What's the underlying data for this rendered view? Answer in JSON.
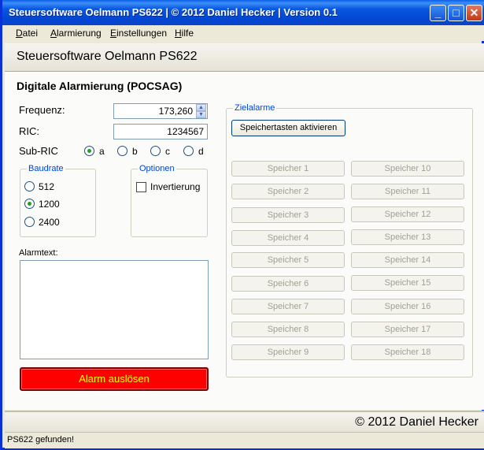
{
  "window": {
    "title": "Steuersoftware Oelmann PS622  |  © 2012 Daniel Hecker  |  Version 0.1",
    "minimize_glyph": "_",
    "maximize_glyph": "□",
    "close_glyph": "✕"
  },
  "menu": {
    "items": [
      {
        "first": "D",
        "rest": "atei"
      },
      {
        "first": "A",
        "rest": "larmierung"
      },
      {
        "first": "E",
        "rest": "instellungen"
      },
      {
        "first": "H",
        "rest": "ilfe"
      }
    ]
  },
  "header": {
    "title": "Steuersoftware Oelmann PS622"
  },
  "main": {
    "section_title": "Digitale Alarmierung (POCSAG)",
    "frequency_label": "Frequenz:",
    "frequency_value": "173,260",
    "spin_up": "▲",
    "spin_down": "▼",
    "ric_label": "RIC:",
    "ric_value": "1234567",
    "subric_label": "Sub-RIC",
    "subric_options": [
      "a",
      "b",
      "c",
      "d"
    ],
    "subric_selected": "a",
    "baudrate": {
      "legend": "Baudrate",
      "options": [
        "512",
        "1200",
        "2400"
      ],
      "selected": "1200"
    },
    "options_group": {
      "legend": "Optionen",
      "invert_label": "Invertierung",
      "invert_checked": false
    },
    "alarmtext_label": "Alarmtext:",
    "alarmtext_value": "",
    "alarm_button": "Alarm auslösen"
  },
  "zielalarme": {
    "legend": "Zielalarme",
    "activate_button": "Speichertasten aktivieren",
    "memory_left": [
      "Speicher 1",
      "Speicher 2",
      "Speicher 3",
      "Speicher 4",
      "Speicher 5",
      "Speicher 6",
      "Speicher 7",
      "Speicher 8",
      "Speicher 9"
    ],
    "memory_right": [
      "Speicher 10",
      "Speicher 11",
      "Speicher 12",
      "Speicher 13",
      "Speicher 14",
      "Speicher 15",
      "Speicher 16",
      "Speicher 17",
      "Speicher 18"
    ]
  },
  "footer": {
    "copyright": "© 2012 Daniel Hecker"
  },
  "status": {
    "text": "PS622 gefunden!"
  }
}
